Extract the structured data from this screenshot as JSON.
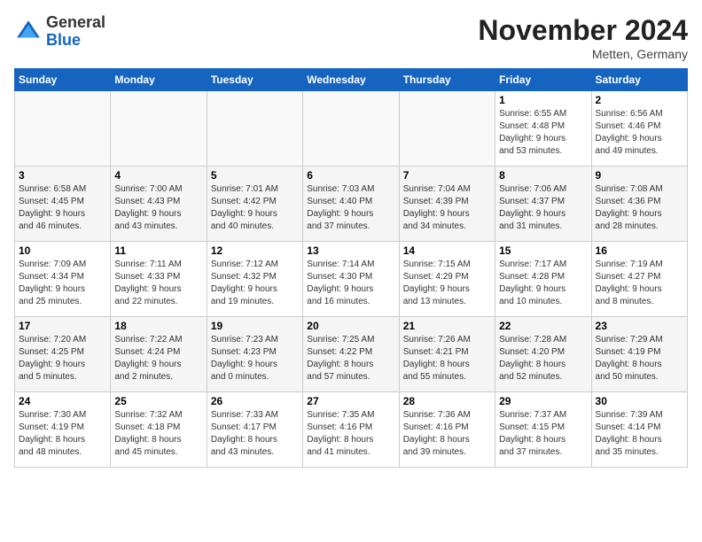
{
  "header": {
    "logo_line1": "General",
    "logo_line2": "Blue",
    "month_title": "November 2024",
    "location": "Metten, Germany"
  },
  "weekdays": [
    "Sunday",
    "Monday",
    "Tuesday",
    "Wednesday",
    "Thursday",
    "Friday",
    "Saturday"
  ],
  "weeks": [
    [
      {
        "day": "",
        "info": ""
      },
      {
        "day": "",
        "info": ""
      },
      {
        "day": "",
        "info": ""
      },
      {
        "day": "",
        "info": ""
      },
      {
        "day": "",
        "info": ""
      },
      {
        "day": "1",
        "info": "Sunrise: 6:55 AM\nSunset: 4:48 PM\nDaylight: 9 hours\nand 53 minutes."
      },
      {
        "day": "2",
        "info": "Sunrise: 6:56 AM\nSunset: 4:46 PM\nDaylight: 9 hours\nand 49 minutes."
      }
    ],
    [
      {
        "day": "3",
        "info": "Sunrise: 6:58 AM\nSunset: 4:45 PM\nDaylight: 9 hours\nand 46 minutes."
      },
      {
        "day": "4",
        "info": "Sunrise: 7:00 AM\nSunset: 4:43 PM\nDaylight: 9 hours\nand 43 minutes."
      },
      {
        "day": "5",
        "info": "Sunrise: 7:01 AM\nSunset: 4:42 PM\nDaylight: 9 hours\nand 40 minutes."
      },
      {
        "day": "6",
        "info": "Sunrise: 7:03 AM\nSunset: 4:40 PM\nDaylight: 9 hours\nand 37 minutes."
      },
      {
        "day": "7",
        "info": "Sunrise: 7:04 AM\nSunset: 4:39 PM\nDaylight: 9 hours\nand 34 minutes."
      },
      {
        "day": "8",
        "info": "Sunrise: 7:06 AM\nSunset: 4:37 PM\nDaylight: 9 hours\nand 31 minutes."
      },
      {
        "day": "9",
        "info": "Sunrise: 7:08 AM\nSunset: 4:36 PM\nDaylight: 9 hours\nand 28 minutes."
      }
    ],
    [
      {
        "day": "10",
        "info": "Sunrise: 7:09 AM\nSunset: 4:34 PM\nDaylight: 9 hours\nand 25 minutes."
      },
      {
        "day": "11",
        "info": "Sunrise: 7:11 AM\nSunset: 4:33 PM\nDaylight: 9 hours\nand 22 minutes."
      },
      {
        "day": "12",
        "info": "Sunrise: 7:12 AM\nSunset: 4:32 PM\nDaylight: 9 hours\nand 19 minutes."
      },
      {
        "day": "13",
        "info": "Sunrise: 7:14 AM\nSunset: 4:30 PM\nDaylight: 9 hours\nand 16 minutes."
      },
      {
        "day": "14",
        "info": "Sunrise: 7:15 AM\nSunset: 4:29 PM\nDaylight: 9 hours\nand 13 minutes."
      },
      {
        "day": "15",
        "info": "Sunrise: 7:17 AM\nSunset: 4:28 PM\nDaylight: 9 hours\nand 10 minutes."
      },
      {
        "day": "16",
        "info": "Sunrise: 7:19 AM\nSunset: 4:27 PM\nDaylight: 9 hours\nand 8 minutes."
      }
    ],
    [
      {
        "day": "17",
        "info": "Sunrise: 7:20 AM\nSunset: 4:25 PM\nDaylight: 9 hours\nand 5 minutes."
      },
      {
        "day": "18",
        "info": "Sunrise: 7:22 AM\nSunset: 4:24 PM\nDaylight: 9 hours\nand 2 minutes."
      },
      {
        "day": "19",
        "info": "Sunrise: 7:23 AM\nSunset: 4:23 PM\nDaylight: 9 hours\nand 0 minutes."
      },
      {
        "day": "20",
        "info": "Sunrise: 7:25 AM\nSunset: 4:22 PM\nDaylight: 8 hours\nand 57 minutes."
      },
      {
        "day": "21",
        "info": "Sunrise: 7:26 AM\nSunset: 4:21 PM\nDaylight: 8 hours\nand 55 minutes."
      },
      {
        "day": "22",
        "info": "Sunrise: 7:28 AM\nSunset: 4:20 PM\nDaylight: 8 hours\nand 52 minutes."
      },
      {
        "day": "23",
        "info": "Sunrise: 7:29 AM\nSunset: 4:19 PM\nDaylight: 8 hours\nand 50 minutes."
      }
    ],
    [
      {
        "day": "24",
        "info": "Sunrise: 7:30 AM\nSunset: 4:19 PM\nDaylight: 8 hours\nand 48 minutes."
      },
      {
        "day": "25",
        "info": "Sunrise: 7:32 AM\nSunset: 4:18 PM\nDaylight: 8 hours\nand 45 minutes."
      },
      {
        "day": "26",
        "info": "Sunrise: 7:33 AM\nSunset: 4:17 PM\nDaylight: 8 hours\nand 43 minutes."
      },
      {
        "day": "27",
        "info": "Sunrise: 7:35 AM\nSunset: 4:16 PM\nDaylight: 8 hours\nand 41 minutes."
      },
      {
        "day": "28",
        "info": "Sunrise: 7:36 AM\nSunset: 4:16 PM\nDaylight: 8 hours\nand 39 minutes."
      },
      {
        "day": "29",
        "info": "Sunrise: 7:37 AM\nSunset: 4:15 PM\nDaylight: 8 hours\nand 37 minutes."
      },
      {
        "day": "30",
        "info": "Sunrise: 7:39 AM\nSunset: 4:14 PM\nDaylight: 8 hours\nand 35 minutes."
      }
    ]
  ]
}
